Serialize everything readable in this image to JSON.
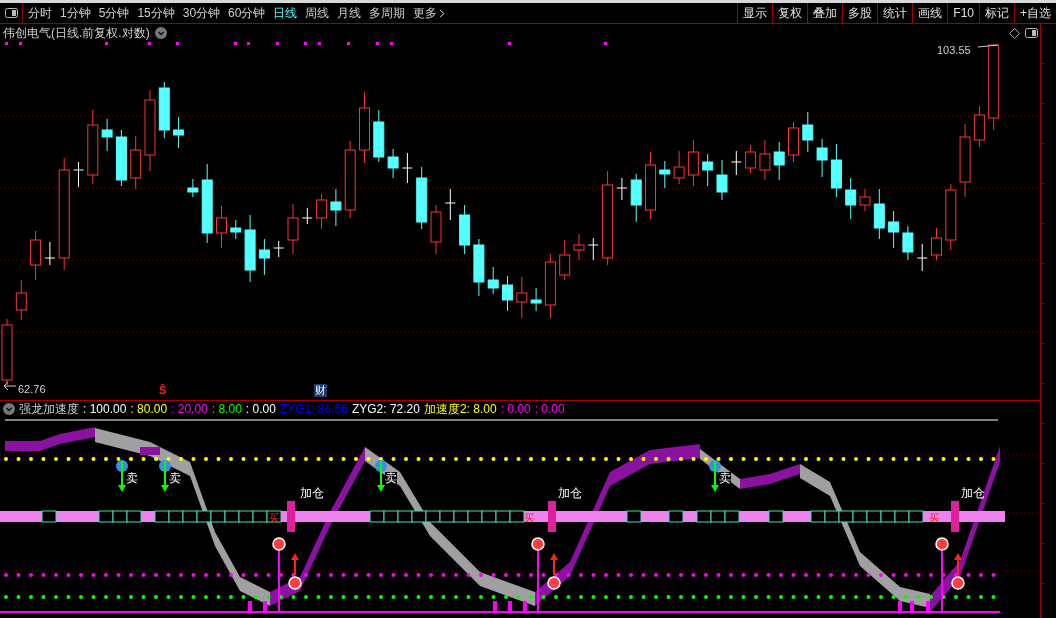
{
  "toolbar": {
    "periods": [
      {
        "label": "分时",
        "selected": false
      },
      {
        "label": "1分钟",
        "selected": false
      },
      {
        "label": "5分钟",
        "selected": false
      },
      {
        "label": "15分钟",
        "selected": false
      },
      {
        "label": "30分钟",
        "selected": false
      },
      {
        "label": "60分钟",
        "selected": false
      },
      {
        "label": "日线",
        "selected": true
      },
      {
        "label": "周线",
        "selected": false
      },
      {
        "label": "月线",
        "selected": false
      },
      {
        "label": "多周期",
        "selected": false
      }
    ],
    "more": "更多",
    "actions": [
      "显示",
      "复权",
      "叠加",
      "多股",
      "统计",
      "画线",
      "F10",
      "标记",
      "+自选"
    ]
  },
  "chart": {
    "title": "伟创电气(日线.前复权.对数)",
    "high_label": "103.55",
    "low_label": "62.76",
    "markers": [
      {
        "kind": "dividend",
        "text": "Ŝ"
      },
      {
        "kind": "finance",
        "text": "财"
      }
    ]
  },
  "indicator": {
    "name": "强龙加速度",
    "values": [
      {
        "text": ": 100.00",
        "color": "#ffffff"
      },
      {
        "text": ": 80.00",
        "color": "#ffff00"
      },
      {
        "text": ": 20.00",
        "color": "#ff00ff"
      },
      {
        "text": ": 8.00",
        "color": "#00ff00"
      },
      {
        "text": ": 0.00",
        "color": "#ffffff"
      },
      {
        "text": "ZYG1: 86.56",
        "color": "#0000ff"
      },
      {
        "text": "ZYG2: 72.20",
        "color": "#ffffff"
      },
      {
        "text": "加速度2: 8.00",
        "color": "#ffff00"
      },
      {
        "text": ": 0.00",
        "color": "#ff00ff"
      },
      {
        "text": ": 0.00",
        "color": "#ff00ff"
      }
    ],
    "signals": [
      {
        "kind": "sell",
        "text": "卖"
      },
      {
        "kind": "sell",
        "text": "卖"
      },
      {
        "kind": "buy",
        "text": "买"
      },
      {
        "kind": "add",
        "text": "加仓"
      },
      {
        "kind": "sell",
        "text": "卖"
      },
      {
        "kind": "buy",
        "text": "买"
      },
      {
        "kind": "add",
        "text": "加仓"
      },
      {
        "kind": "sell",
        "text": "卖"
      },
      {
        "kind": "buy",
        "text": "买"
      },
      {
        "kind": "add",
        "text": "加仓"
      }
    ]
  }
}
